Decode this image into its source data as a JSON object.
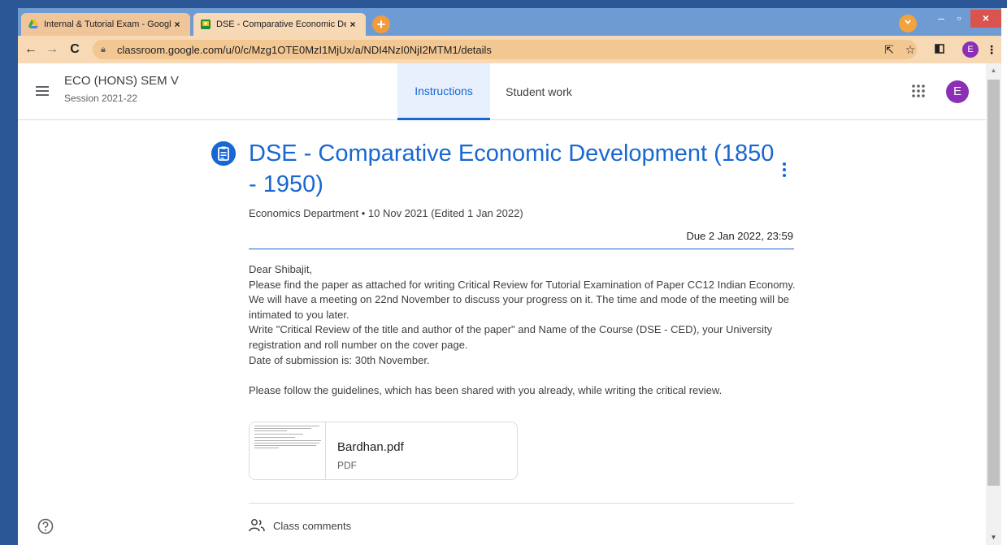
{
  "browser": {
    "tabs": [
      {
        "title": "Internal & Tutorial Exam - Google",
        "favicon": "google-drive-icon",
        "active": false
      },
      {
        "title": "DSE - Comparative Economic De",
        "favicon": "classroom-icon",
        "active": true
      }
    ],
    "new_tab": "+",
    "url": "classroom.google.com/u/0/c/Mzg1OTE0MzI1MjUx/a/NDI4NzI0NjI2MTM1/details",
    "profile_initial": "E",
    "close": "×"
  },
  "header": {
    "course_name": "ECO (HONS) SEM V",
    "session": "Session 2021-22",
    "tabs": [
      "Instructions",
      "Student work"
    ],
    "avatar_initial": "E"
  },
  "assignment": {
    "title": "DSE - Comparative Economic Development (1850 - 1950)",
    "meta": "Economics Department • 10 Nov 2021 (Edited 1 Jan 2022)",
    "due": "Due 2 Jan 2022, 23:59",
    "body_lines": [
      "Dear Shibajit,",
      "Please find the paper as attached for writing Critical Review for Tutorial Examination of Paper CC12 Indian Economy.",
      "We will have a meeting on 22nd November to discuss your progress on it. The time and mode of the meeting will be",
      "intimated to you later.",
      "Write \"Critical Review of the title and author of the paper\" and Name of the Course (DSE - CED), your University",
      "registration and roll number on the cover page.",
      "Date of submission is: 30th November.",
      "",
      "Please follow the guidelines, which has been shared with you already, while writing the critical review."
    ],
    "attachment": {
      "name": "Bardhan.pdf",
      "type": "PDF"
    },
    "class_comments": "Class comments"
  },
  "colors": {
    "accent": "#1967d2",
    "tabstrip": "#6e9bd1",
    "toolbar": "#f7d9b5",
    "avatar": "#8a2fb6"
  }
}
